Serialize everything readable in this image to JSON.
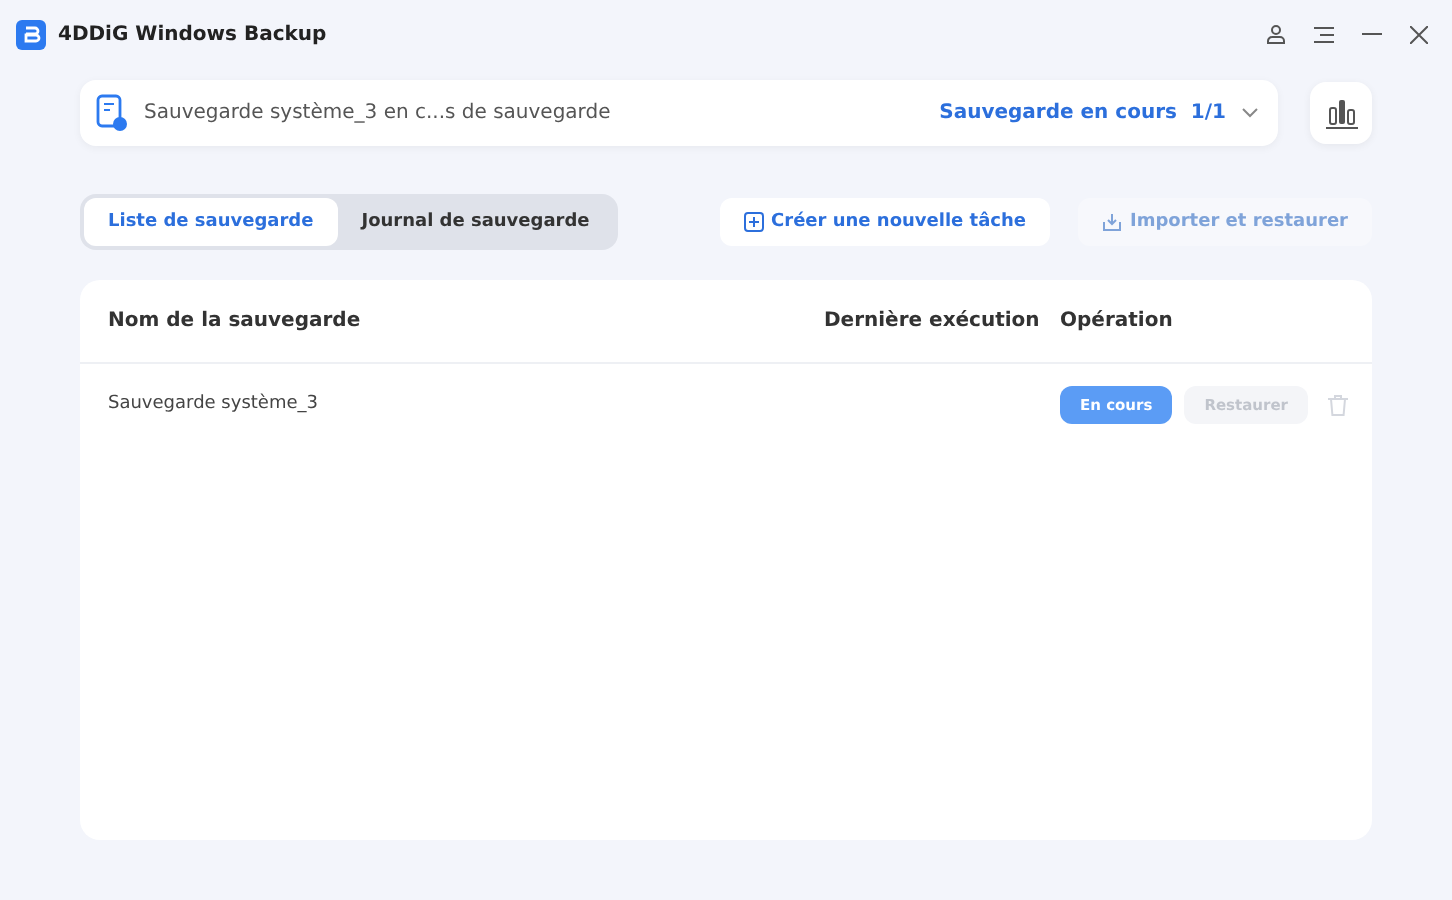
{
  "window": {
    "title": "4DDiG Windows Backup"
  },
  "status": {
    "text": "Sauvegarde système_3 en c...s de sauvegarde",
    "progress": "Sauvegarde en cours  1/1"
  },
  "tabs": [
    {
      "label": "Liste de sauvegarde",
      "selected": true
    },
    {
      "label": "Journal de sauvegarde",
      "selected": false
    }
  ],
  "actions": [
    {
      "label": "Créer une nouvelle tâche",
      "disabled": false,
      "kind": "create"
    },
    {
      "label": "Importer et restaurer",
      "disabled": true,
      "kind": "import"
    }
  ],
  "table": {
    "columns": [
      "Nom de la sauvegarde",
      "Dernière exécution",
      "Opération"
    ],
    "rows": [
      {
        "name": "Sauvegarde système_3",
        "last_run": "",
        "primary": {
          "label": "En cours",
          "disabled": false
        },
        "secondary": {
          "label": "Restaurer",
          "disabled": true
        },
        "delete_disabled": true
      }
    ]
  }
}
